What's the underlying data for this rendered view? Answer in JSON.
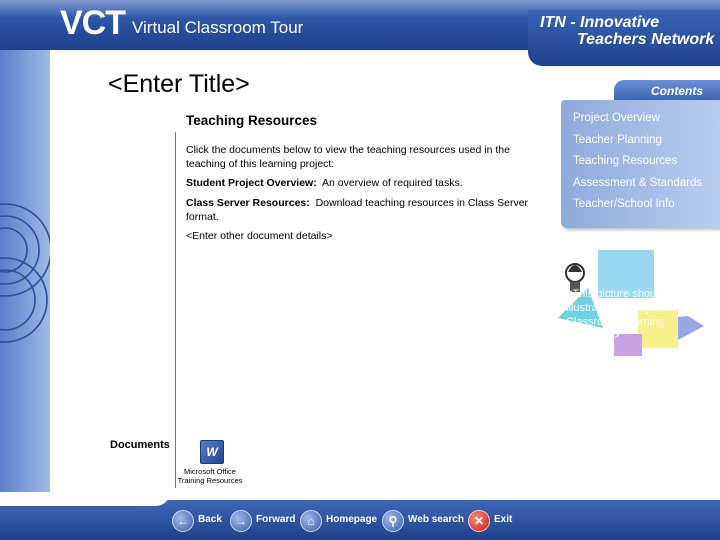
{
  "header": {
    "brand": "VCT",
    "subtitle": "Virtual Classroom Tour",
    "partner_line1": "ITN - Innovative",
    "partner_line2": "Teachers Network"
  },
  "page_title": "<Enter Title>",
  "section": {
    "title": "Teaching Resources",
    "intro": "Click the documents below to view the teaching resources used in the teaching of this learning project:",
    "items": [
      {
        "label": "Student Project Overview:",
        "text": "An overview of required tasks."
      },
      {
        "label": "Class Server Resources:",
        "text": "Download teaching resources in Class Server format."
      }
    ],
    "other": "<Enter other document details>"
  },
  "documents": {
    "label": "Documents",
    "file_caption": "Microsoft Office Training Resources",
    "icon": "word-document-icon"
  },
  "contents": {
    "tab_label": "Contents",
    "items": [
      "Project Overview",
      "Teacher Planning",
      "Teaching Resources",
      "Assessment & Standards",
      "Teacher/School Info"
    ]
  },
  "picture_placeholder": "<This picture should illustrate the subject of your Classroom Learning Resource>",
  "footer_nav": [
    {
      "label": "Back",
      "icon": "back-arrow-icon"
    },
    {
      "label": "Forward",
      "icon": "forward-arrow-icon"
    },
    {
      "label": "Homepage",
      "icon": "home-icon"
    },
    {
      "label": "Web search",
      "icon": "magnifier-icon"
    },
    {
      "label": "Exit",
      "icon": "exit-x-icon"
    }
  ],
  "colors": {
    "header_blue": "#284f9f",
    "panel_blue": "#8eaadc",
    "accent": "#3a62b4"
  }
}
